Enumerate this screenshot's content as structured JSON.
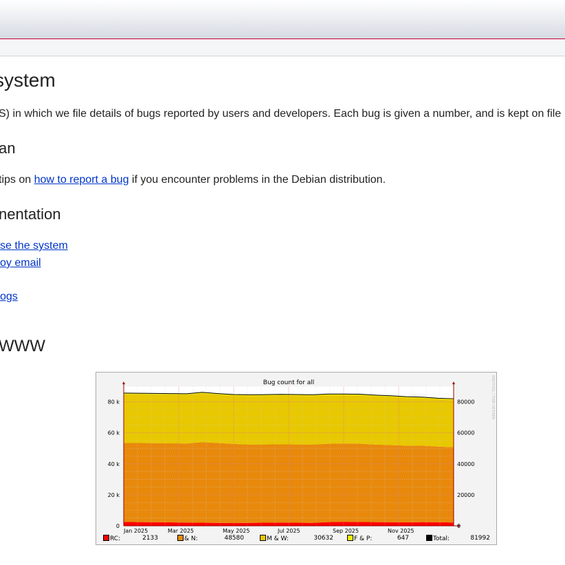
{
  "page": {
    "title": "system",
    "intro": "S) in which we file details of bugs reported by users and developers. Each bug is given a number, and is kept on file",
    "section_report": "an",
    "report_prefix": "tips on ",
    "report_link": "how to report a bug",
    "report_suffix": " if you encounter problems in the Debian distribution.",
    "section_docs": "nentation",
    "doc_links": [
      "se the system",
      "oy email",
      "ogs"
    ],
    "section_www": "WWW"
  },
  "chart_data": {
    "type": "area",
    "title": "Bug count for all",
    "watermark": "RRDTOOL / TOBI OETIKER",
    "x": [
      "Jan 2025",
      "Mar 2025",
      "May 2025",
      "Jul 2025",
      "Sep 2025",
      "Nov 2025"
    ],
    "left_ticks": [
      "0",
      "20 k",
      "40 k",
      "60 k",
      "80 k"
    ],
    "right_ticks": [
      "0",
      "20000",
      "40000",
      "60000",
      "80000"
    ],
    "ylim": [
      0,
      90000
    ],
    "series": [
      {
        "name": "RC:",
        "color": "#ff0000",
        "values": [
          2500,
          2400,
          2300,
          2200,
          2100,
          2000,
          1900,
          1800,
          1900,
          2000,
          2100,
          2000,
          1900,
          2400,
          2600,
          2500,
          2400,
          2300,
          2200,
          2400,
          2300,
          2133
        ]
      },
      {
        "name": "& N:",
        "color": "#e8890c",
        "values": [
          51000,
          51000,
          51000,
          51000,
          51000,
          52000,
          51500,
          51000,
          50500,
          50500,
          50500,
          50500,
          50500,
          50500,
          50500,
          50500,
          50000,
          49800,
          49500,
          49300,
          48800,
          48580
        ]
      },
      {
        "name": "M & W:",
        "color": "#e8c800",
        "values": [
          31500,
          31500,
          31500,
          31500,
          31500,
          31500,
          31300,
          31300,
          31500,
          31500,
          31600,
          31600,
          31500,
          31500,
          31300,
          31300,
          31300,
          31200,
          31000,
          30700,
          30700,
          30632
        ]
      },
      {
        "name": "F & P:",
        "color": "#f0f000",
        "values": [
          600,
          600,
          600,
          600,
          600,
          600,
          600,
          600,
          600,
          600,
          600,
          600,
          600,
          600,
          600,
          600,
          600,
          620,
          630,
          640,
          645,
          647
        ]
      }
    ],
    "total": {
      "name": "Total:",
      "color": "#000000",
      "values": [
        85600,
        85500,
        85400,
        85300,
        85200,
        86100,
        85300,
        84700,
        84500,
        84600,
        84800,
        84700,
        84500,
        85000,
        85000,
        84900,
        84300,
        83900,
        83300,
        83000,
        82300,
        81992
      ]
    },
    "legend": [
      {
        "label": "RC:",
        "value": "2133",
        "color": "#ff0000"
      },
      {
        "label": "& N:",
        "value": "48580",
        "color": "#e8890c"
      },
      {
        "label": "M & W:",
        "value": "30632",
        "color": "#e8c800"
      },
      {
        "label": "F & P:",
        "value": "647",
        "color": "#f0f000"
      },
      {
        "label": "Total:",
        "value": "81992",
        "color": "#000000"
      }
    ]
  }
}
